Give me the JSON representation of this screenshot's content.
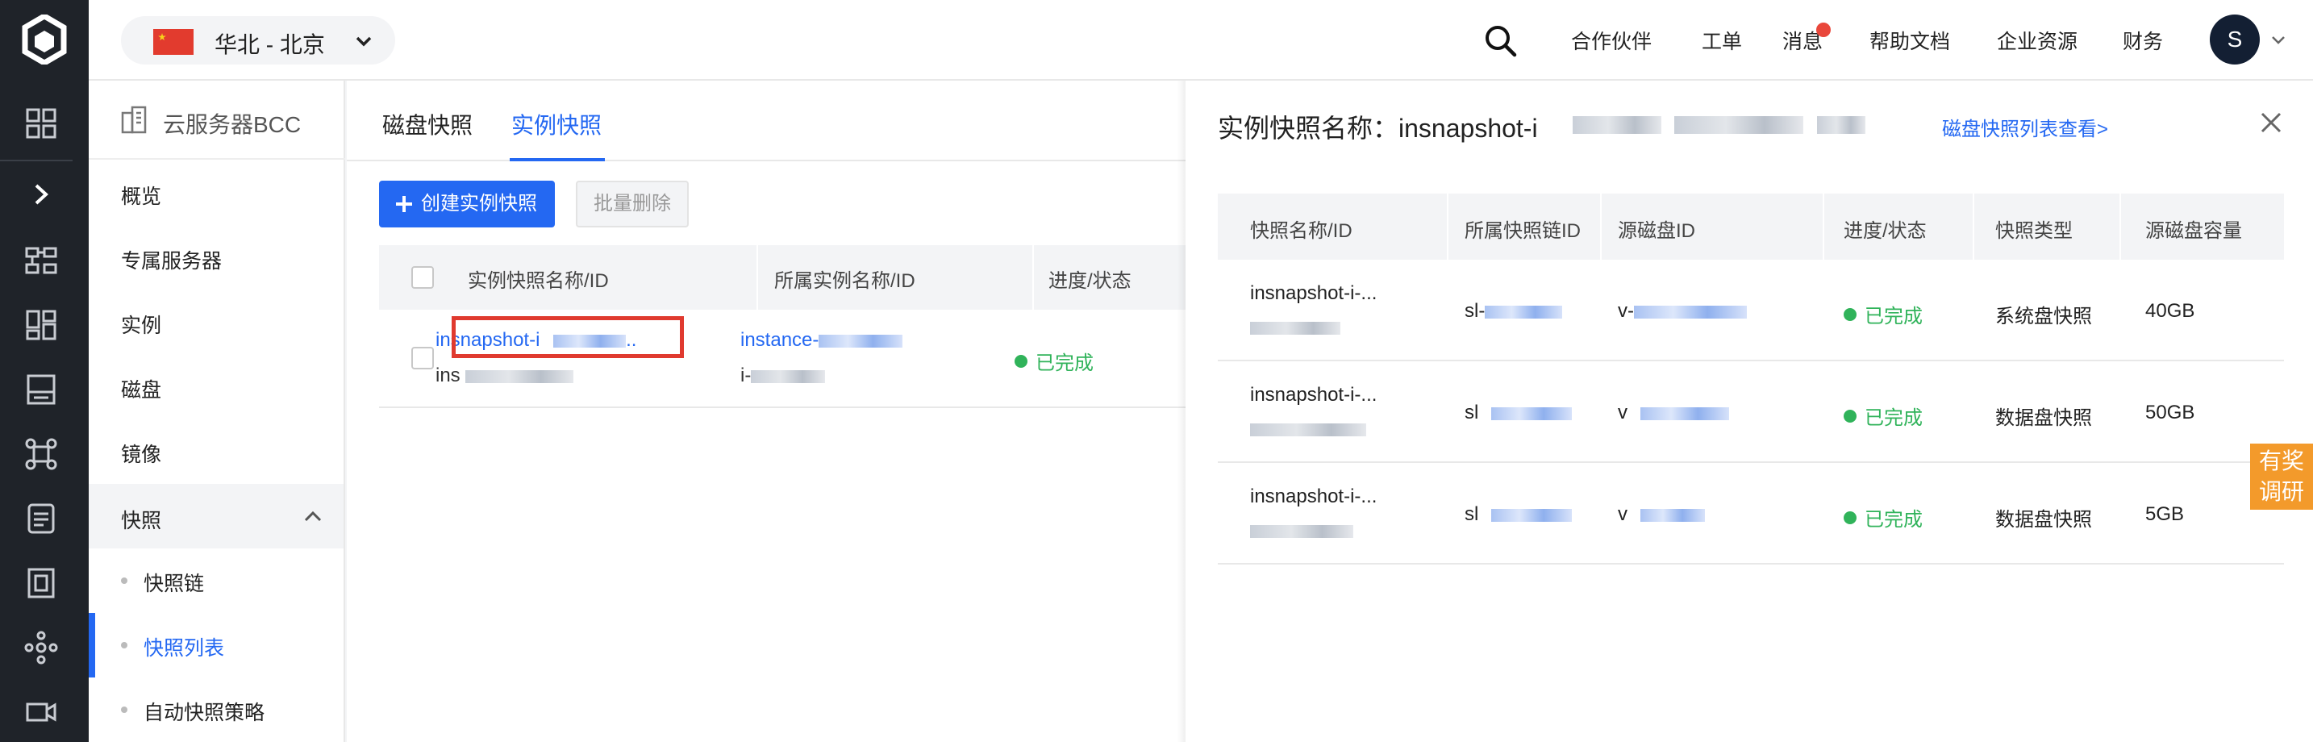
{
  "header": {
    "region": "华北 - 北京",
    "nav": [
      "合作伙伴",
      "工单",
      "消息",
      "帮助文档",
      "企业资源",
      "财务"
    ],
    "avatar_letter": "S"
  },
  "sidebar": {
    "title": "云服务器BCC",
    "items": [
      "概览",
      "专属服务器",
      "实例",
      "磁盘",
      "镜像"
    ],
    "group_label": "快照",
    "sub_items": [
      "快照链",
      "快照列表",
      "自动快照策略"
    ]
  },
  "main": {
    "tabs": [
      "磁盘快照",
      "实例快照"
    ],
    "create_button": "创建实例快照",
    "batch_delete_button": "批量删除",
    "columns": [
      "实例快照名称/ID",
      "所属实例名称/ID",
      "进度/状态"
    ],
    "row": {
      "name": "insnapshot-i",
      "name_suffix": "..",
      "id_prefix": "ins",
      "instance_name": "instance-",
      "instance_id_prefix": "i-",
      "status": "已完成"
    }
  },
  "drawer": {
    "title_prefix": "实例快照名称：",
    "title_name": "insnapshot-i",
    "link": "磁盘快照列表查看>",
    "columns": [
      "快照名称/ID",
      "所属快照链ID",
      "源磁盘ID",
      "进度/状态",
      "快照类型",
      "源磁盘容量"
    ],
    "rows": [
      {
        "name": "insnapshot-i-...",
        "chain_prefix": "sl-",
        "disk_prefix": "v-",
        "status": "已完成",
        "type": "系统盘快照",
        "capacity": "40GB"
      },
      {
        "name": "insnapshot-i-...",
        "chain_prefix": "sl",
        "disk_prefix": "v",
        "status": "已完成",
        "type": "数据盘快照",
        "capacity": "50GB"
      },
      {
        "name": "insnapshot-i-...",
        "chain_prefix": "sl",
        "disk_prefix": "v",
        "status": "已完成",
        "type": "数据盘快照",
        "capacity": "5GB"
      }
    ]
  },
  "survey": {
    "line1": "有奖",
    "line2": "调研"
  },
  "colors": {
    "accent": "#2468f2",
    "success": "#30b35a",
    "rail": "#1f2329",
    "highlight": "#e03a2f",
    "survey": "#f39a2b"
  },
  "icons": [
    "logo-icon",
    "grid-icon",
    "expand-icon",
    "topology-icon",
    "dashboard-icon",
    "storage-icon",
    "network-icon",
    "database-icon",
    "building-icon",
    "cluster-icon",
    "camera-icon",
    "search-icon",
    "chevron-down-icon",
    "chevron-up-icon",
    "close-icon",
    "plus-icon"
  ]
}
